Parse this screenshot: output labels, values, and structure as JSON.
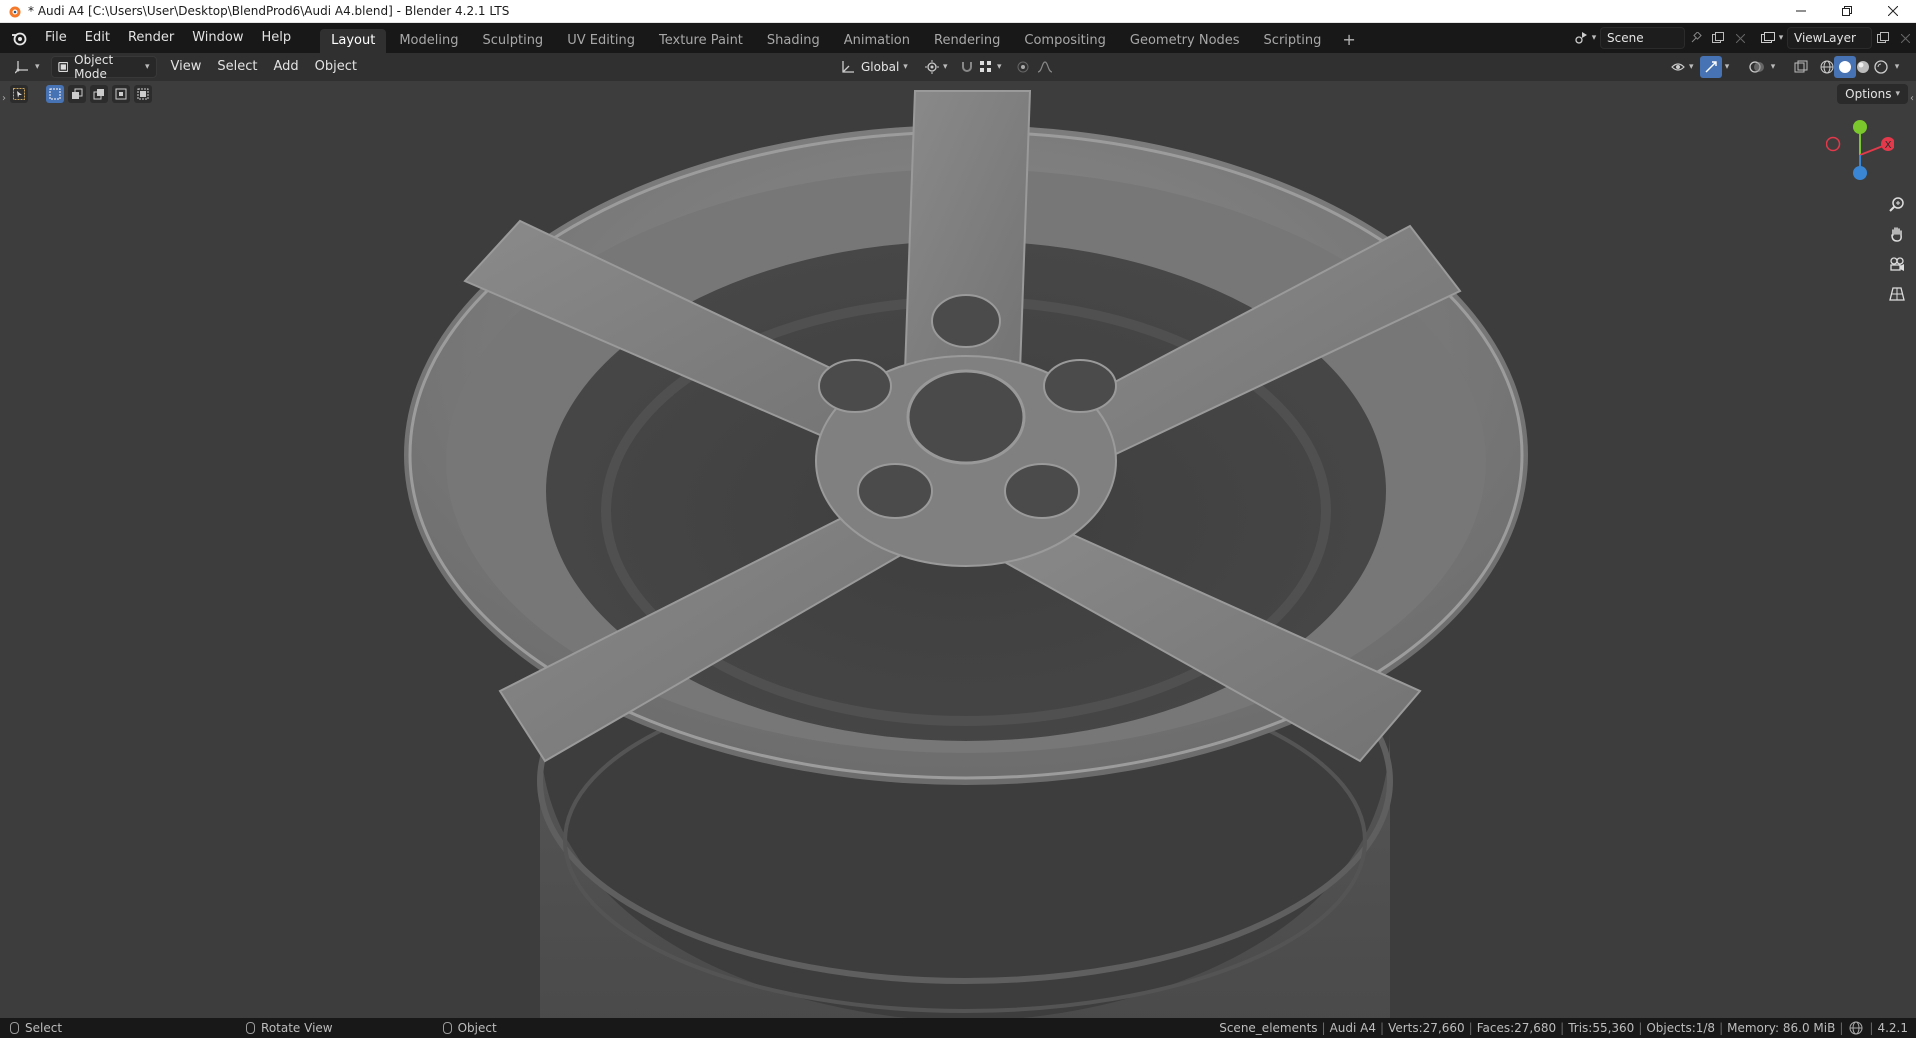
{
  "window": {
    "title": "* Audi A4 [C:\\Users\\User\\Desktop\\BlendProd6\\Audi A4.blend] - Blender 4.2.1 LTS"
  },
  "topbar": {
    "menus": [
      "File",
      "Edit",
      "Render",
      "Window",
      "Help"
    ],
    "workspaces": [
      "Layout",
      "Modeling",
      "Sculpting",
      "UV Editing",
      "Texture Paint",
      "Shading",
      "Animation",
      "Rendering",
      "Compositing",
      "Geometry Nodes",
      "Scripting"
    ],
    "active_workspace": "Layout",
    "add_workspace": "+",
    "scene": "Scene",
    "view_layer": "ViewLayer"
  },
  "viewport_header": {
    "mode": "Object Mode",
    "menus": [
      "View",
      "Select",
      "Add",
      "Object"
    ],
    "transform_orientation": "Global"
  },
  "viewport": {
    "options_label": "Options"
  },
  "statusbar": {
    "hints": [
      "Select",
      "Rotate View",
      "Object"
    ],
    "stats": {
      "collection": "Scene_elements",
      "object": "Audi A4",
      "verts": "Verts:27,660",
      "faces": "Faces:27,680",
      "tris": "Tris:55,360",
      "objects": "Objects:1/8",
      "memory": "Memory: 86.0 MiB",
      "version": "4.2.1"
    }
  },
  "colors": {
    "accent": "#4772b3",
    "axis_x": "#e4394b",
    "axis_y": "#7ac82c",
    "axis_z": "#3a86d4",
    "viewport_bg": "#3d3d3d",
    "wheel": "#7a7a7a"
  },
  "icons": {
    "app": "blender-icon",
    "editor_type": "3d-viewport-icon",
    "nav": [
      "zoom-icon",
      "hand-pan-icon",
      "camera-icon",
      "grid-icon"
    ]
  }
}
